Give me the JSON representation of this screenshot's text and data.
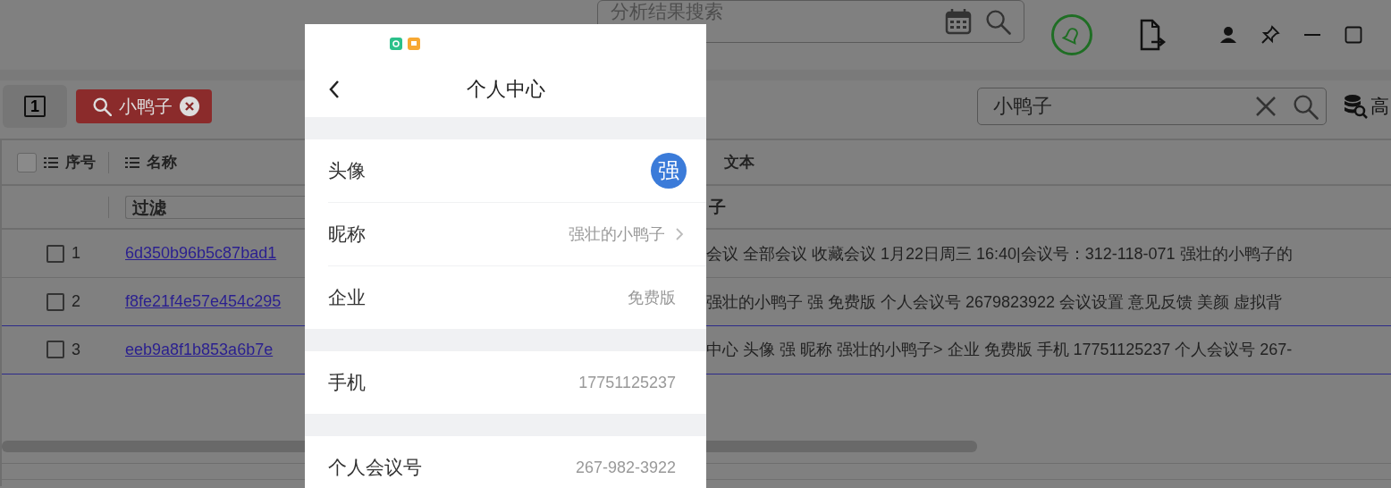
{
  "top_bar": {
    "search": {
      "placeholder": "分析结果搜索"
    }
  },
  "toolbar": {
    "page_button": "1",
    "filter_chips": [
      {
        "label": "小鸭子"
      }
    ],
    "search": {
      "value": "小鸭子"
    },
    "advanced_label": "高"
  },
  "table": {
    "header_checked": false,
    "columns": [
      {
        "label": "序号"
      },
      {
        "label": "名称"
      },
      {
        "label": "文本"
      }
    ],
    "filters": [
      "过滤",
      "子"
    ],
    "rows": [
      {
        "index": "1",
        "name": "6d350b96b5c87bad1",
        "text": "会议 全部会议 收藏会议 1月22日周三 16:40|会议号：312-118-071 强壮的小鸭子的",
        "checked": false,
        "selected": false
      },
      {
        "index": "2",
        "name": "f8fe21f4e57e454c295",
        "text": " 强壮的小鸭子 强 免费版 个人会议号 2679823922 会议设置 意见反馈 美颜 虚拟背",
        "checked": false,
        "selected": false
      },
      {
        "index": "3",
        "name": "eeb9a8f1b853a6b7e",
        "text": "中心 头像 强 昵称 强壮的小鸭子> 企业 免费版 手机 17751125237 个人会议号 267-",
        "checked": false,
        "selected": true
      }
    ]
  },
  "preview": {
    "title": "个人中心",
    "sections": [
      {
        "items": [
          {
            "label": "头像",
            "kind": "avatar",
            "value": "强"
          },
          {
            "label": "昵称",
            "kind": "link",
            "value": "强壮的小鸭子"
          },
          {
            "label": "企业",
            "kind": "text",
            "value": "免费版"
          }
        ]
      },
      {
        "items": [
          {
            "label": "手机",
            "kind": "text",
            "value": "17751125237"
          }
        ]
      },
      {
        "items": [
          {
            "label": "个人会议号",
            "kind": "text",
            "value": "267-982-3922"
          }
        ]
      }
    ]
  }
}
